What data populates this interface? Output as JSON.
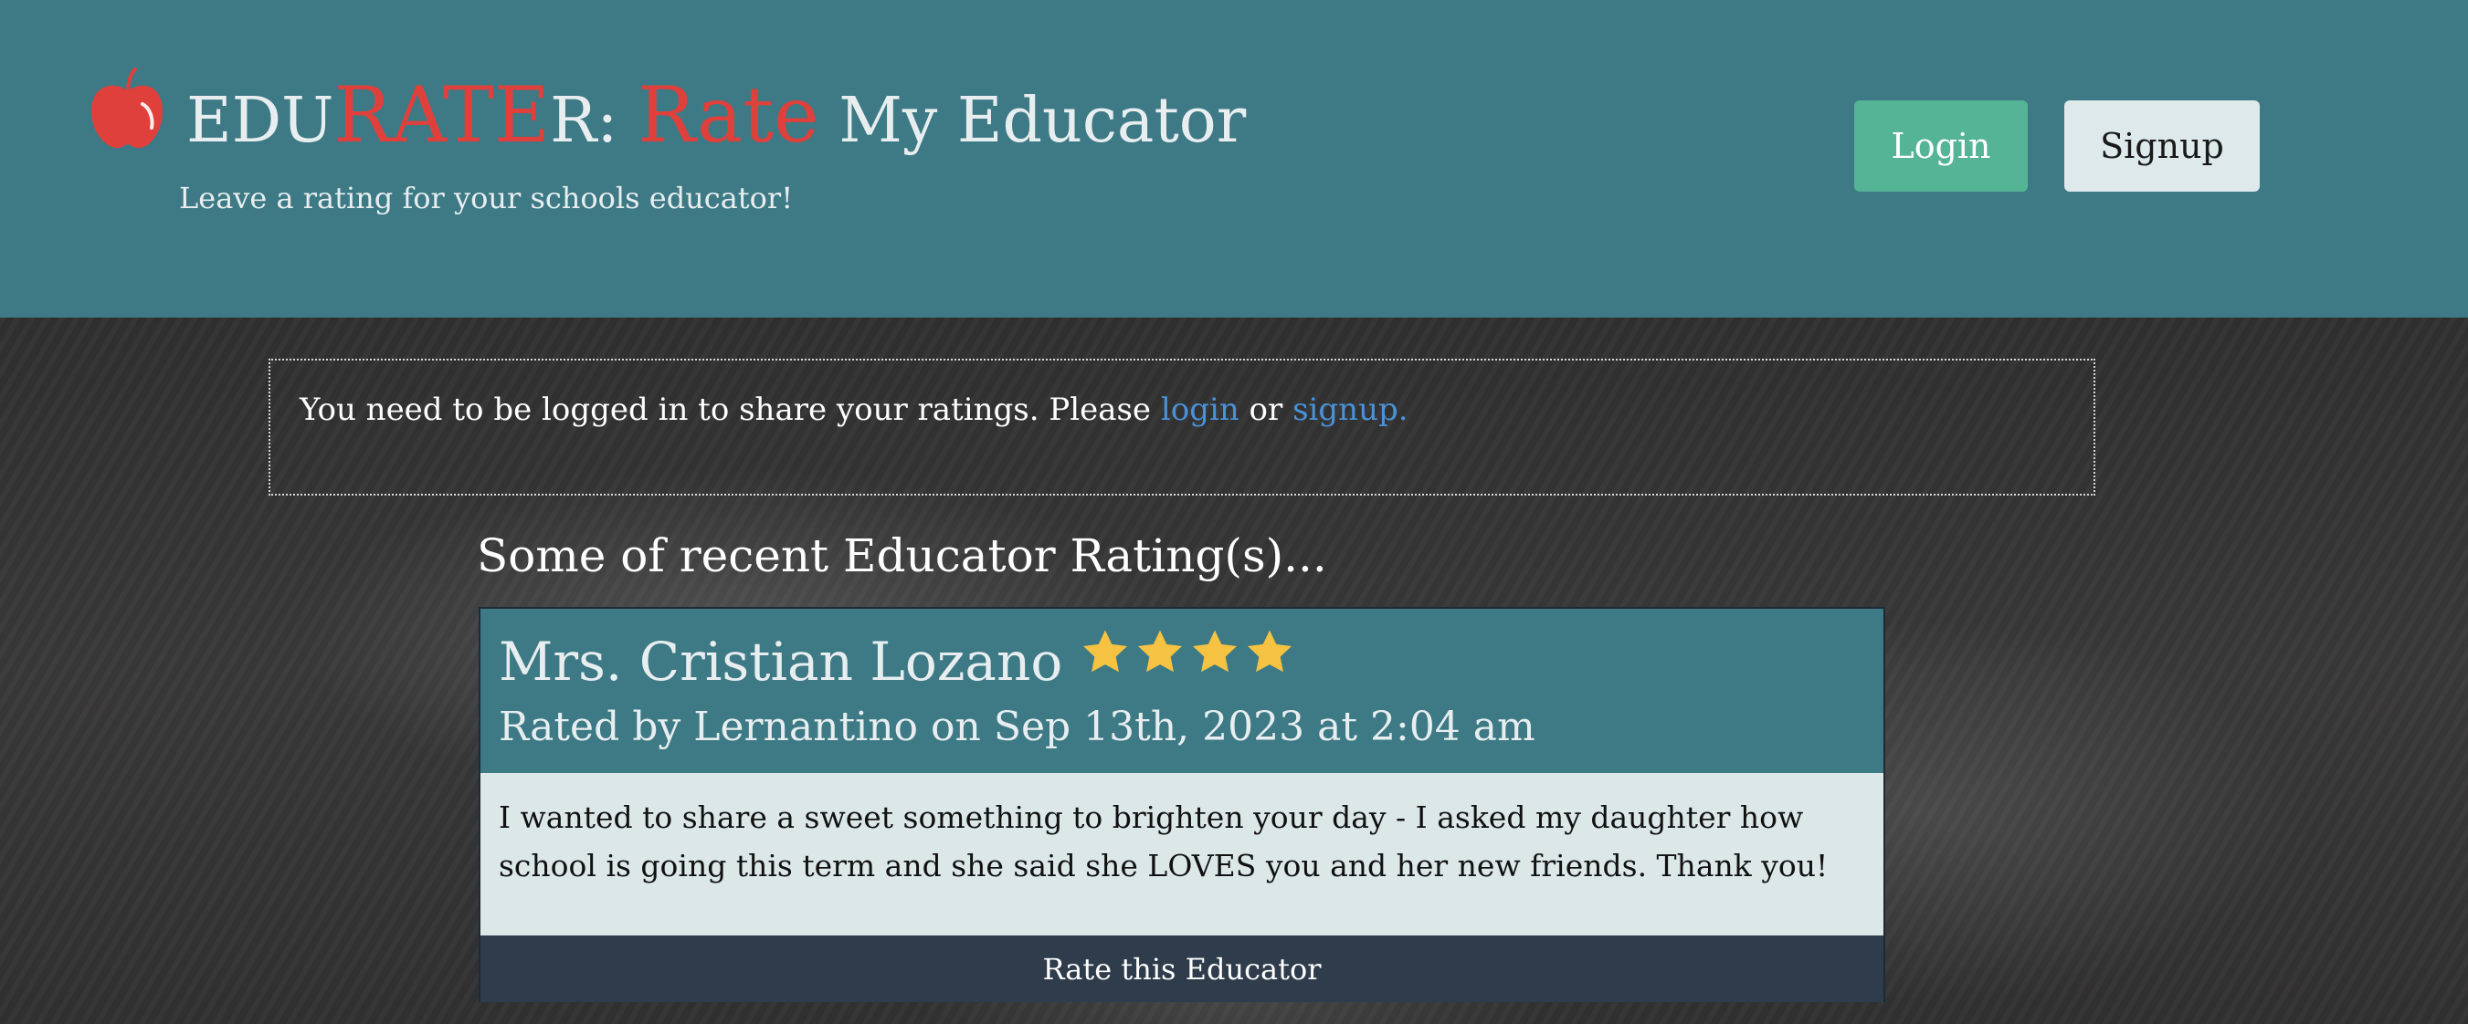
{
  "header": {
    "title_parts": {
      "edu": "EDU",
      "rate": "RATE",
      "r": "R:",
      "rate_word": "Rate",
      "rest": " My Educator"
    },
    "subtitle": "Leave a rating for your schools educator!",
    "login_label": "Login",
    "signup_label": "Signup",
    "logo_icon": "apple-icon"
  },
  "notice": {
    "text_before": "You need to be logged in to share your ratings. Please ",
    "login_link": "login",
    "text_middle": " or ",
    "signup_link": "signup."
  },
  "recent": {
    "heading": "Some of recent Educator Rating(s)..."
  },
  "ratings": [
    {
      "educator": "Mrs. Cristian Lozano",
      "stars": 4,
      "rated_by": "Rated by Lernantino on Sep 13th, 2023 at 2:04 am",
      "text": "I wanted to share a sweet something to brighten your day - I asked my daughter how school is going this term and she said she LOVES you and her new friends. Thank you!",
      "action_label": "Rate this Educator"
    }
  ],
  "colors": {
    "header_bg": "#3d7a85",
    "accent_red": "#e0403c",
    "login_btn": "#55b396",
    "signup_btn": "#dde9ea",
    "link": "#4a92d8",
    "star": "#f5c242",
    "card_footer": "#2f3c4b"
  }
}
